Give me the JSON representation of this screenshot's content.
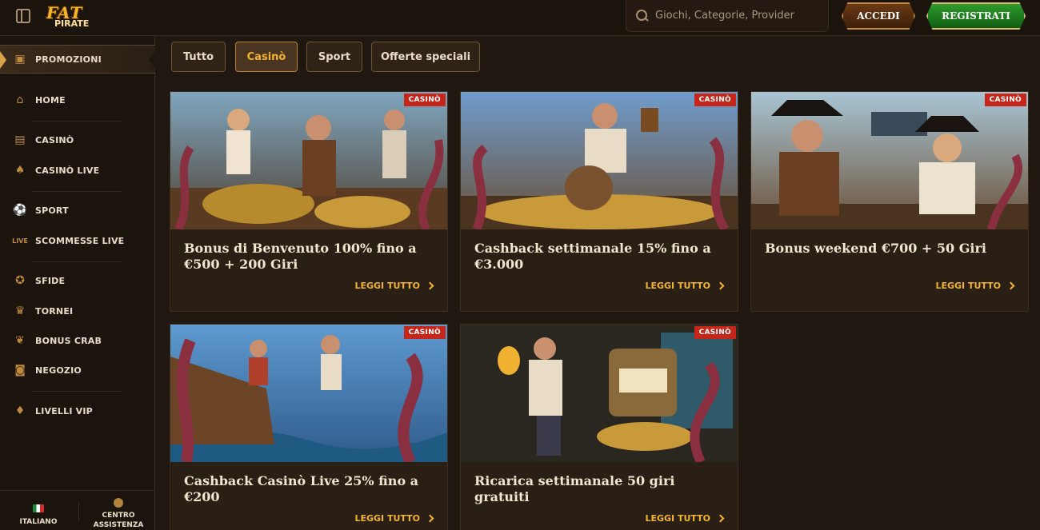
{
  "header": {
    "logo_top": "FAT",
    "logo_bottom": "PIRATE",
    "search_placeholder": "Giochi, Categorie, Provider",
    "login_label": "ACCEDI",
    "register_label": "REGISTRATI"
  },
  "sidebar": {
    "items": [
      {
        "label": "PROMOZIONI",
        "icon": "chest-icon"
      },
      {
        "label": "HOME",
        "icon": "home-icon"
      },
      {
        "label": "CASINÒ",
        "icon": "casino-icon"
      },
      {
        "label": "CASINÒ LIVE",
        "icon": "cards-icon"
      },
      {
        "label": "SPORT",
        "icon": "ball-icon"
      },
      {
        "label": "SCOMMESSE LIVE",
        "icon": "live-icon"
      },
      {
        "label": "SFIDE",
        "icon": "medal-icon"
      },
      {
        "label": "TORNEI",
        "icon": "trophy-icon"
      },
      {
        "label": "BONUS CRAB",
        "icon": "crab-icon"
      },
      {
        "label": "NEGOZIO",
        "icon": "bag-icon"
      },
      {
        "label": "LIVELLI VIP",
        "icon": "diamond-icon"
      }
    ],
    "footer": {
      "language": "ITALIANO",
      "support_line1": "CENTRO",
      "support_line2": "ASSISTENZA"
    }
  },
  "tabs": [
    {
      "label": "Tutto",
      "active": false
    },
    {
      "label": "Casinò",
      "active": true
    },
    {
      "label": "Sport",
      "active": false
    },
    {
      "label": "Offerte speciali",
      "active": false
    }
  ],
  "promos": [
    {
      "badge": "CASINÒ",
      "title": "Bonus di Benvenuto 100% fino a €500 + 200 Giri",
      "more": "LEGGI TUTTO"
    },
    {
      "badge": "CASINÒ",
      "title": "Cashback settimanale 15% fino a €3.000",
      "more": "LEGGI TUTTO"
    },
    {
      "badge": "CASINÒ",
      "title": "Bonus weekend €700 + 50 Giri",
      "more": "LEGGI TUTTO"
    },
    {
      "badge": "CASINÒ",
      "title": "Cashback Casinò Live 25% fino a €200",
      "more": "LEGGI TUTTO"
    },
    {
      "badge": "CASINÒ",
      "title": "Ricarica settimanale 50 giri gratuiti",
      "more": "LEGGI TUTTO"
    }
  ],
  "colors": {
    "accent": "#f3b52a",
    "badge": "#c6261a",
    "bg": "#1f1710"
  }
}
